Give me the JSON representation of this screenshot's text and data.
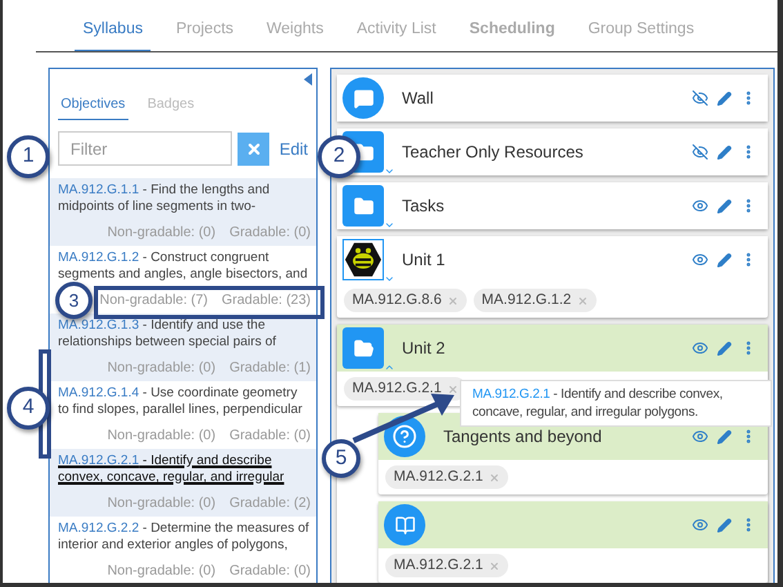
{
  "tabs": [
    {
      "label": "Syllabus",
      "selected": true,
      "bold": false
    },
    {
      "label": "Projects",
      "selected": false,
      "bold": false
    },
    {
      "label": "Weights",
      "selected": false,
      "bold": false
    },
    {
      "label": "Activity List",
      "selected": false,
      "bold": false
    },
    {
      "label": "Scheduling",
      "selected": false,
      "bold": true
    },
    {
      "label": "Group Settings",
      "selected": false,
      "bold": false
    }
  ],
  "objectives_panel": {
    "tabs": [
      {
        "label": "Objectives",
        "selected": true
      },
      {
        "label": "Badges",
        "selected": false
      }
    ],
    "filter": {
      "placeholder": "Filter"
    },
    "edit_link": "Edit",
    "objectives": [
      {
        "code": "MA.912.G.1.1",
        "text": " - Find the lengths and midpoints of line segments in two-",
        "non_gradable": "Non-gradable: (0)",
        "gradable": "Gradable: (0)",
        "highlighted": false
      },
      {
        "code": "MA.912.G.1.2",
        "text": " - Construct congruent segments and angles, angle bisectors, and",
        "non_gradable": "Non-gradable: (7)",
        "gradable": "Gradable: (23)",
        "highlighted": false
      },
      {
        "code": "MA.912.G.1.3",
        "text": " - Identify and use the relationships between special pairs of",
        "non_gradable": "Non-gradable: (0)",
        "gradable": "Gradable: (1)",
        "highlighted": false
      },
      {
        "code": "MA.912.G.1.4",
        "text": " - Use coordinate geometry to find slopes, parallel lines, perpendicular",
        "non_gradable": "Non-gradable: (0)",
        "gradable": "Gradable: (0)",
        "highlighted": false
      },
      {
        "code": "MA.912.G.2.1",
        "text": " - Identify and describe convex, concave, regular, and irregular",
        "non_gradable": "Non-gradable: (0)",
        "gradable": "Gradable: (2)",
        "highlighted": true
      },
      {
        "code": "MA.912.G.2.2",
        "text": " - Determine the measures of interior and exterior angles of polygons,",
        "non_gradable": "Non-gradable: (0)",
        "gradable": "Gradable: (0)",
        "highlighted": false
      }
    ]
  },
  "syllabus_items": [
    {
      "title": "Wall",
      "kind": "chat",
      "visible": false,
      "highlighted": false
    },
    {
      "title": "Teacher Only Resources",
      "kind": "folder",
      "expanded": false,
      "visible": false,
      "highlighted": false
    },
    {
      "title": "Tasks",
      "kind": "folder",
      "expanded": false,
      "visible": true,
      "highlighted": false
    },
    {
      "title": "Unit 1",
      "kind": "image",
      "expanded": false,
      "visible": true,
      "highlighted": false,
      "tags": [
        "MA.912.G.8.6",
        "MA.912.G.1.2"
      ]
    },
    {
      "title": "Unit 2",
      "kind": "folder",
      "expanded": true,
      "visible": true,
      "highlighted": true,
      "tags": [
        "MA.912.G.2.1"
      ],
      "tooltip": {
        "code": "MA.912.G.2.1",
        "text": " - Identify and describe convex, concave, regular, and irregular polygons."
      },
      "children": [
        {
          "title": "Tangents and beyond",
          "kind": "question",
          "visible": true,
          "highlighted": true,
          "tags": [
            "MA.912.G.2.1"
          ]
        },
        {
          "kind": "book",
          "visible": true,
          "highlighted": true,
          "tags": [
            "MA.912.G.2.1"
          ]
        }
      ]
    }
  ],
  "callouts": [
    {
      "number": "1"
    },
    {
      "number": "2"
    },
    {
      "number": "3"
    },
    {
      "number": "4"
    },
    {
      "number": "5"
    }
  ]
}
